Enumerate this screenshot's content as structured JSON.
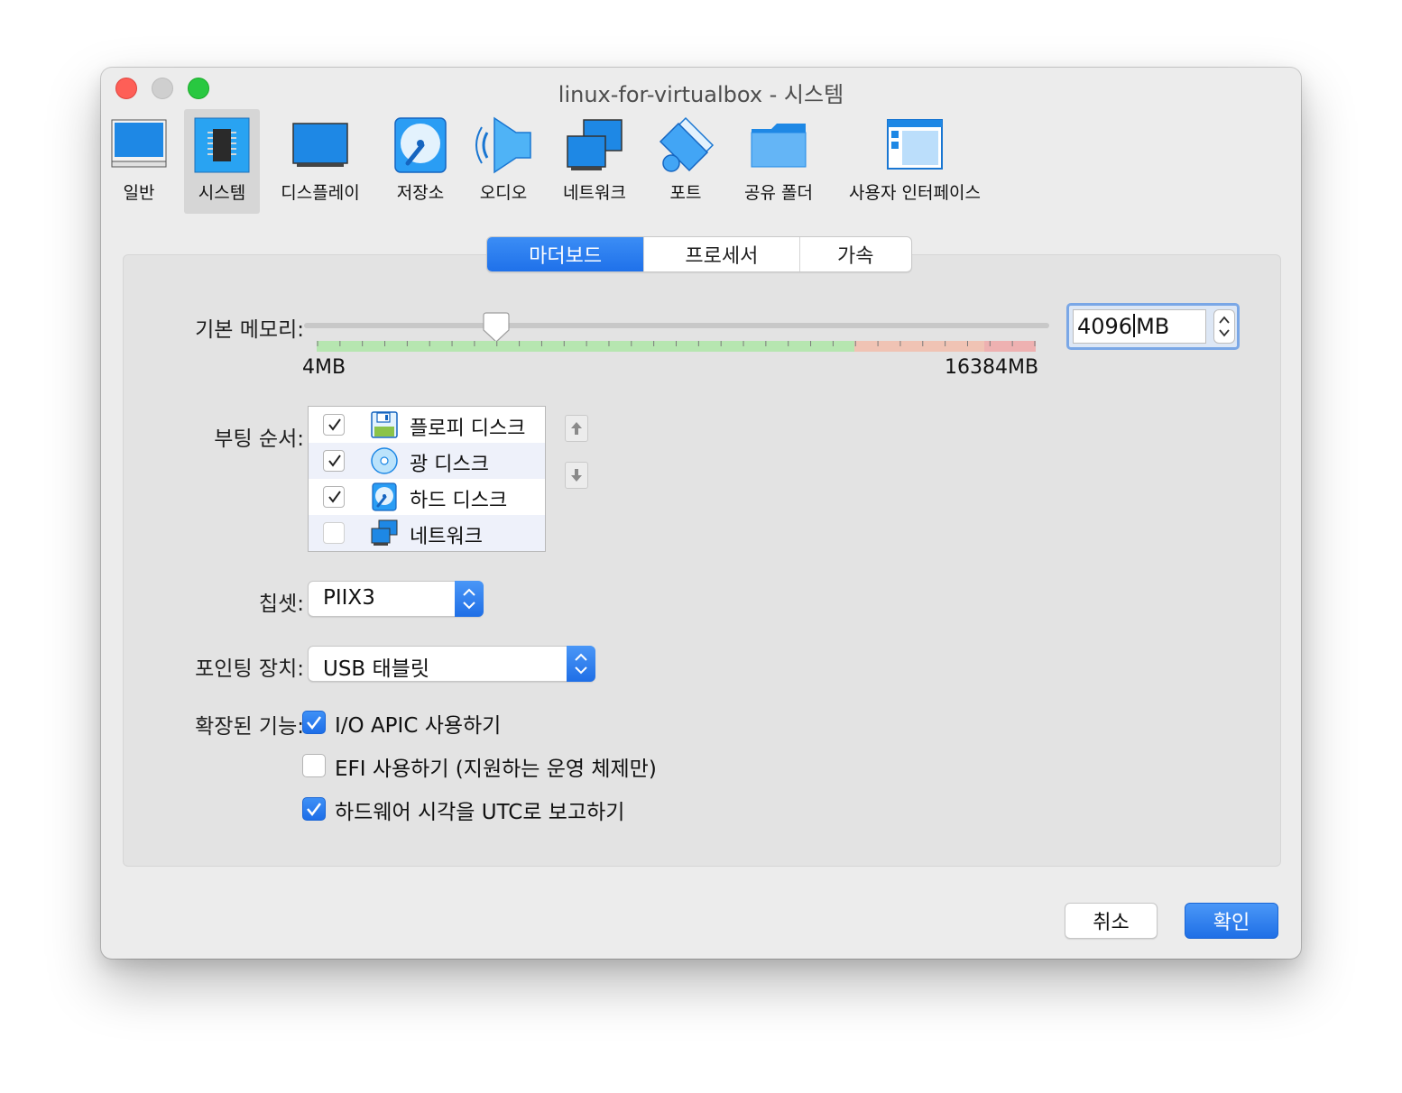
{
  "window": {
    "title": "linux-for-virtualbox - 시스템"
  },
  "toolbar": {
    "items": [
      {
        "label": "일반",
        "icon": "general-icon"
      },
      {
        "label": "시스템",
        "icon": "system-chip-icon",
        "selected": true
      },
      {
        "label": "디스플레이",
        "icon": "display-monitor-icon"
      },
      {
        "label": "저장소",
        "icon": "storage-disk-icon"
      },
      {
        "label": "오디오",
        "icon": "audio-speaker-icon"
      },
      {
        "label": "네트워크",
        "icon": "network-icon"
      },
      {
        "label": "포트",
        "icon": "ports-icon"
      },
      {
        "label": "공유 폴더",
        "icon": "shared-folder-icon"
      },
      {
        "label": "사용자 인터페이스",
        "icon": "user-interface-icon"
      }
    ]
  },
  "tabs": [
    "마더보드",
    "프로세서",
    "가속"
  ],
  "active_tab": "마더보드",
  "memory": {
    "label": "기본 메모리:",
    "min_label": "4MB",
    "max_label": "16384MB",
    "value": "4096",
    "unit": "MB",
    "slider_fraction": 0.25
  },
  "boot_order": {
    "label": "부팅 순서:",
    "items": [
      {
        "label": "플로피 디스크",
        "checked": true,
        "icon": "floppy-icon"
      },
      {
        "label": "광 디스크",
        "checked": true,
        "icon": "optical-disc-icon"
      },
      {
        "label": "하드 디스크",
        "checked": true,
        "icon": "hard-disk-icon"
      },
      {
        "label": "네트워크",
        "checked": false,
        "icon": "network-icon"
      }
    ]
  },
  "chipset": {
    "label": "칩셋:",
    "value": "PIIX3"
  },
  "pointing": {
    "label": "포인팅 장치:",
    "value": "USB 태블릿"
  },
  "extended": {
    "label": "확장된 기능:",
    "options": [
      {
        "label": "I/O APIC 사용하기",
        "checked": true
      },
      {
        "label": "EFI 사용하기 (지원하는 운영 체제만)",
        "checked": false
      },
      {
        "label": "하드웨어 시각을 UTC로 보고하기",
        "checked": true
      }
    ]
  },
  "buttons": {
    "cancel": "취소",
    "ok": "확인"
  },
  "colors": {
    "accent": "#1f71ea",
    "scale_green": "#b6e6b0",
    "scale_orange": "#f0c3b4",
    "scale_red": "#eeb1b1"
  }
}
